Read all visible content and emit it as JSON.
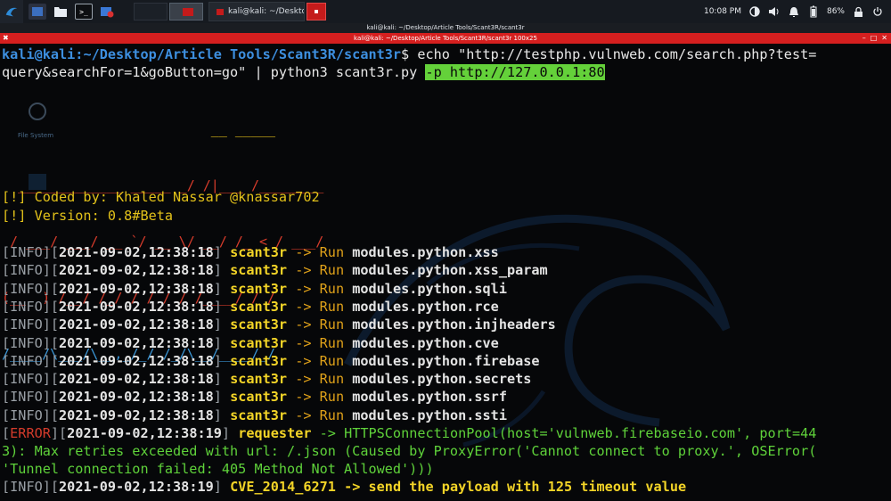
{
  "panel": {
    "task_title": "kali@kali: ~/Desktop/Ar...",
    "clock": "10:08 PM",
    "battery": "86%"
  },
  "window": {
    "title": "kali@kali: ~/Desktop/Article Tools/Scant3R/scant3r",
    "terminal_title": "kali@kali: ~/Desktop/Article Tools/Scant3R/scant3r 100x25"
  },
  "desktop": {
    "icon_filesystem": "File System"
  },
  "terminal": {
    "prompt_user": "kali@kali",
    "prompt_path": ":~/Desktop/Article Tools/Scant3R/scant3r",
    "prompt_symbol": "$",
    "command_part1": " echo \"http://testphp.vulnweb.com/search.php?test=",
    "command_part2": "query&searchFor=1&goButton=go\" | python3 scant3r.py ",
    "command_highlight": "-p http://127.0.0.1:80",
    "ascii_art": [
      "                          __ _____ ",
      "  _____________ _____ _/ /|___ /________",
      " / ___/ ___/ __ `/ __ \\/ __/ /_ < / ___/",
      "(__  ) /__/ /_/ / / / / /____/ / /    ",
      "/____/\\___/\\__,_/_/ /_/\\__/____/_/    "
    ],
    "coded_by": "[!] Coded by: Khaled Nassar @knassar702",
    "version": "[!] Version: 0.8#Beta",
    "logs": [
      {
        "tag": "INFO",
        "time": "2021-09-02,12:38:18",
        "source": "scant3r",
        "arrow": " -> Run ",
        "msg": "modules.python.xss"
      },
      {
        "tag": "INFO",
        "time": "2021-09-02,12:38:18",
        "source": "scant3r",
        "arrow": " -> Run ",
        "msg": "modules.python.xss_param"
      },
      {
        "tag": "INFO",
        "time": "2021-09-02,12:38:18",
        "source": "scant3r",
        "arrow": " -> Run ",
        "msg": "modules.python.sqli"
      },
      {
        "tag": "INFO",
        "time": "2021-09-02,12:38:18",
        "source": "scant3r",
        "arrow": " -> Run ",
        "msg": "modules.python.rce"
      },
      {
        "tag": "INFO",
        "time": "2021-09-02,12:38:18",
        "source": "scant3r",
        "arrow": " -> Run ",
        "msg": "modules.python.injheaders"
      },
      {
        "tag": "INFO",
        "time": "2021-09-02,12:38:18",
        "source": "scant3r",
        "arrow": " -> Run ",
        "msg": "modules.python.cve"
      },
      {
        "tag": "INFO",
        "time": "2021-09-02,12:38:18",
        "source": "scant3r",
        "arrow": " -> Run ",
        "msg": "modules.python.firebase"
      },
      {
        "tag": "INFO",
        "time": "2021-09-02,12:38:18",
        "source": "scant3r",
        "arrow": " -> Run ",
        "msg": "modules.python.secrets"
      },
      {
        "tag": "INFO",
        "time": "2021-09-02,12:38:18",
        "source": "scant3r",
        "arrow": " -> Run ",
        "msg": "modules.python.ssrf"
      },
      {
        "tag": "INFO",
        "time": "2021-09-02,12:38:18",
        "source": "scant3r",
        "arrow": " -> Run ",
        "msg": "modules.python.ssti"
      }
    ],
    "error": {
      "tag": "ERROR",
      "time": "2021-09-02,12:38:19",
      "source": "requester",
      "line1": " -> HTTPSConnectionPool(host='vulnweb.firebaseio.com', port=44",
      "line2": "3): Max retries exceeded with url: /.json (Caused by ProxyError('Cannot connect to proxy.', OSError(",
      "line3": "'Tunnel connection failed: 405 Method Not Allowed')))"
    },
    "last": {
      "tag": "INFO",
      "time": "2021-09-02,12:38:19",
      "source": "CVE_2014_6271",
      "msg": " -> send the payload with 125 timeout value"
    }
  }
}
